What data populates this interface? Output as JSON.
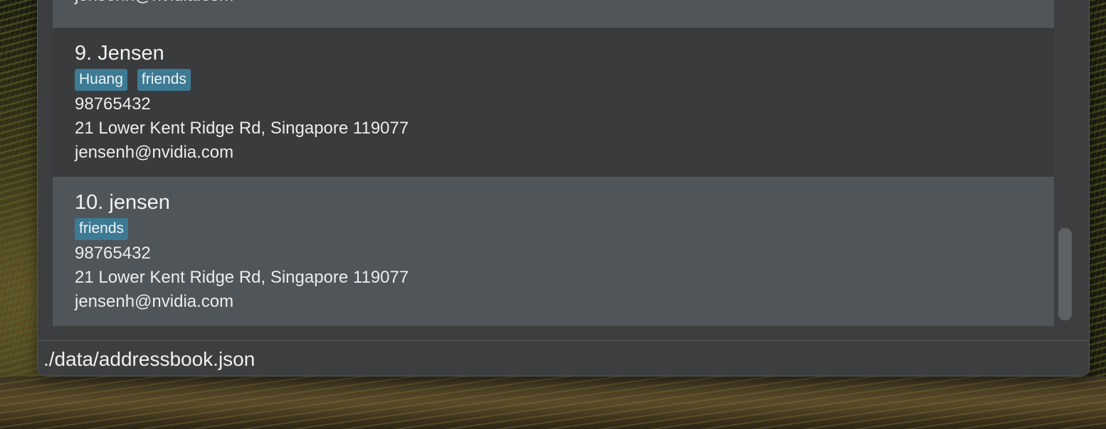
{
  "persons": [
    {
      "name": "",
      "tags": [],
      "phone": "",
      "address": "",
      "email": "jensenh@nvidia.com"
    },
    {
      "name": "9. Jensen",
      "tags": [
        "Huang",
        "friends"
      ],
      "phone": "98765432",
      "address": "21 Lower Kent Ridge Rd, Singapore 119077",
      "email": "jensenh@nvidia.com"
    },
    {
      "name": "10. jensen",
      "tags": [
        "friends"
      ],
      "phone": "98765432",
      "address": "21 Lower Kent Ridge Rd, Singapore 119077",
      "email": "jensenh@nvidia.com"
    }
  ],
  "status_bar": {
    "file_path": "./data/addressbook.json"
  },
  "colors": {
    "tag_background": "#3d7a94",
    "card_light": "#505559",
    "card_dark": "#3a3b3d",
    "window_background": "#3c3e40"
  }
}
